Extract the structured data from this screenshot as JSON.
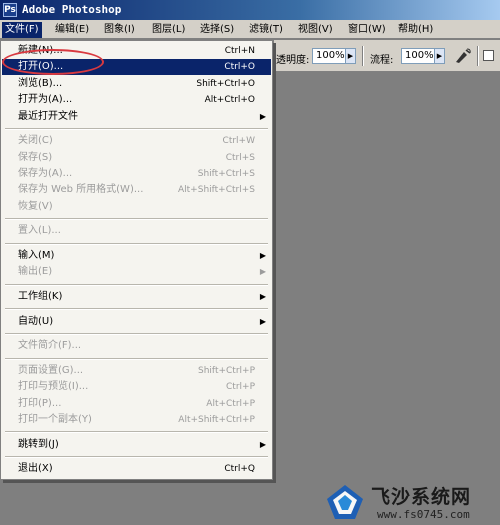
{
  "window": {
    "title": "Adobe Photoshop",
    "app_icon": "photoshop-app-icon"
  },
  "menubar": [
    {
      "label": "文件(F)",
      "active": true
    },
    {
      "label": "编辑(E)"
    },
    {
      "label": "图象(I)"
    },
    {
      "label": "图层(L)"
    },
    {
      "label": "选择(S)"
    },
    {
      "label": "滤镜(T)"
    },
    {
      "label": "视图(V)"
    },
    {
      "label": "窗口(W)"
    },
    {
      "label": "帮助(H)"
    }
  ],
  "options_bar": {
    "opacity_label": "透明度:",
    "opacity_value": "100%",
    "flow_label": "流程:",
    "flow_value": "100%",
    "brush_icon": "airbrush-icon"
  },
  "file_menu": {
    "items": [
      {
        "label": "新建(N)...",
        "shortcut": "Ctrl+N"
      },
      {
        "label": "打开(O)...",
        "shortcut": "Ctrl+O",
        "highlighted": true
      },
      {
        "label": "浏览(B)...",
        "shortcut": "Shift+Ctrl+O"
      },
      {
        "label": "打开为(A)...",
        "shortcut": "Alt+Ctrl+O"
      },
      {
        "label": "最近打开文件",
        "submenu": true
      },
      {
        "separator": true
      },
      {
        "label": "关闭(C)",
        "shortcut": "Ctrl+W",
        "disabled": true
      },
      {
        "label": "保存(S)",
        "shortcut": "Ctrl+S",
        "disabled": true
      },
      {
        "label": "保存为(A)...",
        "shortcut": "Shift+Ctrl+S",
        "disabled": true
      },
      {
        "label": "保存为 Web 所用格式(W)...",
        "shortcut": "Alt+Shift+Ctrl+S",
        "disabled": true
      },
      {
        "label": "恢复(V)",
        "disabled": true
      },
      {
        "separator": true
      },
      {
        "label": "置入(L)...",
        "disabled": true
      },
      {
        "separator": true
      },
      {
        "label": "输入(M)",
        "submenu": true
      },
      {
        "label": "输出(E)",
        "submenu": true,
        "disabled": true
      },
      {
        "separator": true
      },
      {
        "label": "工作组(K)",
        "submenu": true
      },
      {
        "separator": true
      },
      {
        "label": "自动(U)",
        "submenu": true
      },
      {
        "separator": true
      },
      {
        "label": "文件简介(F)...",
        "disabled": true
      },
      {
        "separator": true
      },
      {
        "label": "页面设置(G)...",
        "shortcut": "Shift+Ctrl+P",
        "disabled": true
      },
      {
        "label": "打印与预览(I)...",
        "shortcut": "Ctrl+P",
        "disabled": true
      },
      {
        "label": "打印(P)...",
        "shortcut": "Alt+Ctrl+P",
        "disabled": true
      },
      {
        "label": "打印一个副本(Y)",
        "shortcut": "Alt+Shift+Ctrl+P",
        "disabled": true
      },
      {
        "separator": true
      },
      {
        "label": "跳转到(J)",
        "submenu": true
      },
      {
        "separator": true
      },
      {
        "label": "退出(X)",
        "shortcut": "Ctrl+Q"
      }
    ]
  },
  "watermark": {
    "name": "飞沙系统网",
    "url": "www.fs0745.com",
    "logo": "fs-logo-icon"
  },
  "colors": {
    "highlight": "#0a246a",
    "workspace": "#7f7f7f",
    "annotation": "#d9393f"
  }
}
